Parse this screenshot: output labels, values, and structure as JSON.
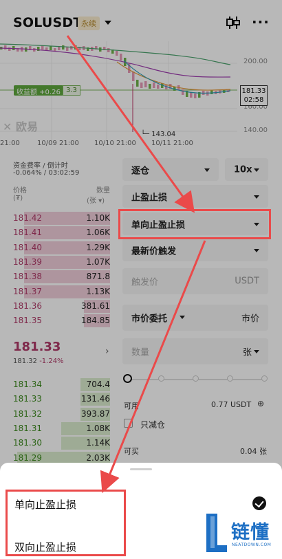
{
  "header": {
    "symbol": "SOLUSDT",
    "contract_tag": "永续"
  },
  "chart": {
    "price_labels": [
      "200.00",
      "160.00",
      "140.00"
    ],
    "pnl_label": "收益额 +0.26",
    "pnl_qty": "3.3",
    "last_price": "181.33",
    "countdown": "02:58",
    "low_label": "143.04",
    "dates": [
      "21:00",
      "10/09 21:00",
      "10/10 21:00",
      "10/11 21:00"
    ],
    "watermark": "欧易",
    "colors": {
      "accent": "#b03a68",
      "positive": "#3c8a1e",
      "annotation": "#ea4a4a"
    }
  },
  "orderbook": {
    "funding_label": "资金费率 / 倒计时",
    "funding_value": "-0.064% / 03:02:59",
    "price_header": "价格",
    "price_unit": "(₮)",
    "qty_header": "数量",
    "qty_unit": "(张 ▾)",
    "asks": [
      {
        "price": "181.42",
        "qty": "1.10K",
        "depth": 0.88
      },
      {
        "price": "181.41",
        "qty": "1.06K",
        "depth": 0.88
      },
      {
        "price": "181.40",
        "qty": "1.29K",
        "depth": 0.88
      },
      {
        "price": "181.39",
        "qty": "1.07K",
        "depth": 0.88
      },
      {
        "price": "181.38",
        "qty": "871.8",
        "depth": 0.88
      },
      {
        "price": "181.37",
        "qty": "1.13K",
        "depth": 0.88
      },
      {
        "price": "181.36",
        "qty": "381.61",
        "depth": 0.27
      },
      {
        "price": "181.35",
        "qty": "184.85",
        "depth": 0.27
      }
    ],
    "mid_price": "181.33",
    "mark_price": "181.32",
    "change": "-1.24%",
    "bids": [
      {
        "price": "181.34",
        "qty": "704.4",
        "depth": 0.3
      },
      {
        "price": "181.33",
        "qty": "131.46",
        "depth": 0.3
      },
      {
        "price": "181.32",
        "qty": "393.87",
        "depth": 0.3
      },
      {
        "price": "181.31",
        "qty": "1.08K",
        "depth": 0.5
      },
      {
        "price": "181.30",
        "qty": "1.14K",
        "depth": 0.5
      },
      {
        "price": "181.29",
        "qty": "2.03K",
        "depth": 0.95
      }
    ]
  },
  "form": {
    "margin_mode": "逐仓",
    "leverage": "10x",
    "order_type": "止盈止损",
    "tpsl_mode": "单向止盈止损",
    "trigger_type": "最新价触发",
    "trigger_placeholder": "触发价",
    "trigger_unit": "USDT",
    "price_type": "市价委托",
    "price_value": "市价",
    "qty_placeholder": "数量",
    "qty_unit": "张",
    "available_label": "可用",
    "available_value": "0.77 USDT",
    "reduce_only": "只减仓",
    "can_buy_label": "可买",
    "can_buy_value": "0.04 张"
  },
  "sheet": {
    "options": [
      "单向止盈止损",
      "双向止盈止损"
    ],
    "selected_index": 0
  },
  "brand": {
    "name": "链懂",
    "domain": "NEATDOWN.COM"
  }
}
